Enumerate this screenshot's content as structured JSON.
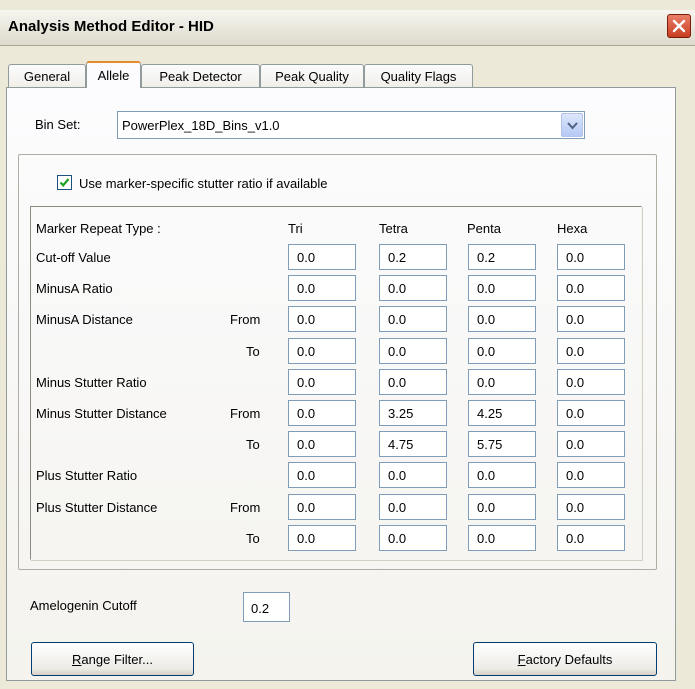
{
  "window": {
    "title": "Analysis Method Editor - HID"
  },
  "tabs": [
    "General",
    "Allele",
    "Peak Detector",
    "Peak Quality",
    "Quality Flags"
  ],
  "active_tab": "Allele",
  "bin_set": {
    "label": "Bin Set:",
    "value": "PowerPlex_18D_Bins_v1.0"
  },
  "stutter": {
    "checkbox_label": "Use marker-specific stutter ratio if available",
    "checked": true,
    "header_label": "Marker Repeat Type :",
    "columns": [
      "Tri",
      "Tetra",
      "Penta",
      "Hexa"
    ],
    "rows": [
      {
        "label": "Cut-off Value",
        "sub": "",
        "values": [
          "0.0",
          "0.2",
          "0.2",
          "0.0"
        ]
      },
      {
        "label": "MinusA Ratio",
        "sub": "",
        "values": [
          "0.0",
          "0.0",
          "0.0",
          "0.0"
        ]
      },
      {
        "label": "MinusA Distance",
        "sub": "From",
        "values": [
          "0.0",
          "0.0",
          "0.0",
          "0.0"
        ]
      },
      {
        "label": "",
        "sub": "To",
        "values": [
          "0.0",
          "0.0",
          "0.0",
          "0.0"
        ]
      },
      {
        "label": "Minus Stutter Ratio",
        "sub": "",
        "values": [
          "0.0",
          "0.0",
          "0.0",
          "0.0"
        ]
      },
      {
        "label": "Minus Stutter Distance",
        "sub": "From",
        "values": [
          "0.0",
          "3.25",
          "4.25",
          "0.0"
        ]
      },
      {
        "label": "",
        "sub": "To",
        "values": [
          "0.0",
          "4.75",
          "5.75",
          "0.0"
        ]
      },
      {
        "label": "Plus Stutter Ratio",
        "sub": "",
        "values": [
          "0.0",
          "0.0",
          "0.0",
          "0.0"
        ]
      },
      {
        "label": "Plus Stutter Distance",
        "sub": "From",
        "values": [
          "0.0",
          "0.0",
          "0.0",
          "0.0"
        ]
      },
      {
        "label": "",
        "sub": "To",
        "values": [
          "0.0",
          "0.0",
          "0.0",
          "0.0"
        ]
      }
    ]
  },
  "amelogenin": {
    "label": "Amelogenin Cutoff",
    "value": "0.2"
  },
  "buttons": {
    "range_filter": {
      "mnemonic": "R",
      "rest": "ange Filter..."
    },
    "factory_defaults": {
      "mnemonic": "F",
      "rest": "actory Defaults"
    }
  },
  "icons": {
    "close": "close-icon",
    "dropdown": "chevron-down-icon",
    "check": "check-icon"
  },
  "colors": {
    "close_button": "#c83c20",
    "active_tab_accent": "#e68b2c",
    "field_border": "#7f9db9"
  }
}
